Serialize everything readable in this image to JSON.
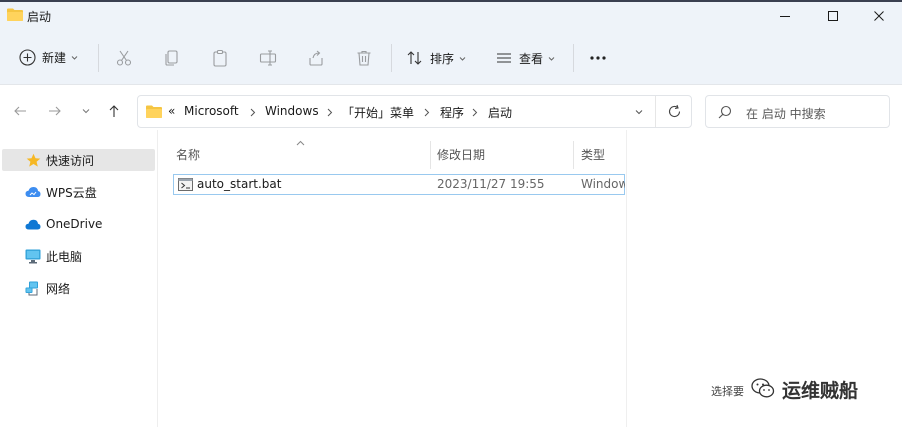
{
  "window": {
    "title": "启动",
    "controls": [
      "minimize-icon",
      "maximize-icon",
      "close-icon"
    ]
  },
  "toolbar": {
    "new_label": "新建",
    "sort_label": "排序",
    "view_label": "查看",
    "more_label": "···",
    "icons": [
      "cut-icon",
      "copy-icon",
      "paste-icon",
      "rename-icon",
      "share-icon",
      "delete-icon"
    ]
  },
  "navigation": {
    "back": "back-arrow-icon",
    "forward": "forward-arrow-icon",
    "recent": "chevron-down-icon",
    "up": "up-arrow-icon"
  },
  "address": {
    "overflow": "«",
    "path": [
      "Microsoft",
      "Windows",
      "「开始」菜单",
      "程序",
      "启动"
    ]
  },
  "search": {
    "placeholder": "在 启动 中搜索"
  },
  "sidebar": {
    "items": [
      {
        "label": "快速访问",
        "icon": "star-icon",
        "selected": true
      },
      {
        "label": "WPS云盘",
        "icon": "wps-cloud-icon",
        "selected": false
      },
      {
        "label": "OneDrive",
        "icon": "onedrive-cloud-icon",
        "selected": false
      },
      {
        "label": "此电脑",
        "icon": "computer-icon",
        "selected": false
      },
      {
        "label": "网络",
        "icon": "network-icon",
        "selected": false
      }
    ]
  },
  "columns": {
    "name": "名称",
    "modified": "修改日期",
    "type": "类型"
  },
  "files": [
    {
      "name": "auto_start.bat",
      "modified": "2023/11/27 19:55",
      "type": "Window"
    }
  ],
  "watermark": {
    "small": "选择要",
    "brand": "运维贼船"
  },
  "colors": {
    "chrome_bg": "#eef3f9",
    "folder": "#f5c542",
    "accent": "#0067c0",
    "selection_border": "#99c9ef"
  }
}
